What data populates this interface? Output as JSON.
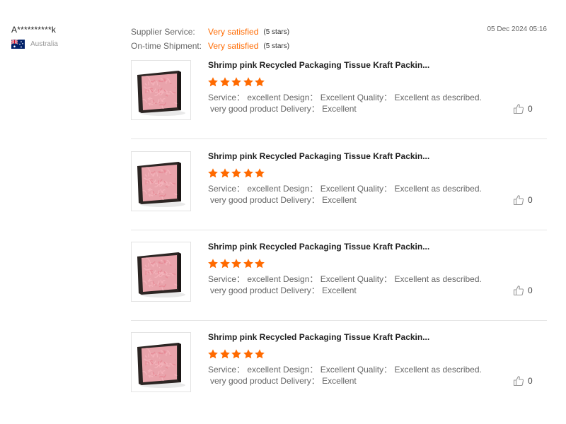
{
  "reviewer": {
    "name": "A**********k",
    "country": "Australia",
    "flag_icon": "australia-flag-icon"
  },
  "ratings": [
    {
      "label": "Supplier Service:",
      "value": "Very satisfied",
      "stars_text": "(5 stars)"
    },
    {
      "label": "On-time Shipment:",
      "value": "Very satisfied",
      "stars_text": "(5 stars)"
    }
  ],
  "date": "05 Dec 2024 05:16",
  "colors": {
    "accent": "#ff6a00",
    "star": "#ff6a00",
    "divider": "#e5e5e5"
  },
  "reviews": [
    {
      "product_title": "Shrimp pink Recycled Packaging Tissue Kraft Packin...",
      "stars": 5,
      "text_line1": "Service： excellent  Design：  Excellent Quality：  Excellent as described.",
      "text_line2": "very good product Delivery：  Excellent",
      "helpful_count": "0"
    },
    {
      "product_title": "Shrimp pink Recycled Packaging Tissue Kraft Packin...",
      "stars": 5,
      "text_line1": "Service： excellent  Design：  Excellent Quality：  Excellent as described.",
      "text_line2": "very good product Delivery：  Excellent",
      "helpful_count": "0"
    },
    {
      "product_title": "Shrimp pink Recycled Packaging Tissue Kraft Packin...",
      "stars": 5,
      "text_line1": "Service： excellent  Design：  Excellent Quality：  Excellent as described.",
      "text_line2": "very good product Delivery：  Excellent",
      "helpful_count": "0"
    },
    {
      "product_title": "Shrimp pink Recycled Packaging Tissue Kraft Packin...",
      "stars": 5,
      "text_line1": "Service： excellent  Design：  Excellent Quality：  Excellent as described.",
      "text_line2": "very good product Delivery：  Excellent",
      "helpful_count": "0"
    }
  ]
}
